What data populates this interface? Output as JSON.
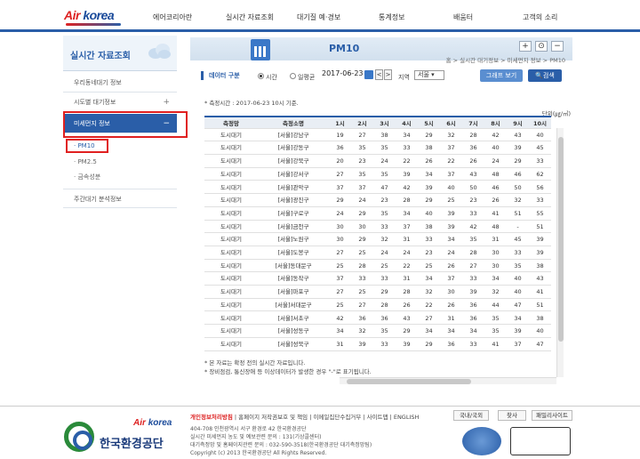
{
  "header": {
    "logo_air": "Air",
    "logo_korea": "korea",
    "nav": [
      "에어코리아란",
      "실시간 자료조회",
      "대기질 예·경보",
      "통계정보",
      "배움터",
      "고객의 소리"
    ]
  },
  "sidebar": {
    "title": "실시간 자료조회",
    "items": [
      {
        "label": "우리동네대기 정보",
        "plus": ""
      },
      {
        "label": "시도별 대기정보",
        "plus": "+"
      },
      {
        "label": "미세먼지 정보",
        "plus": "−"
      },
      {
        "label": "주간대기 분석정보",
        "plus": ""
      }
    ],
    "subitems": [
      "PM10",
      "PM2.5",
      "금속성분"
    ]
  },
  "page": {
    "title": "PM10",
    "breadcrumb": "홈 > 실시간 대기정보 > 미세먼지 정보 > PM10",
    "zoom_in": "+",
    "zoom_reset": "⊙",
    "zoom_out": "−"
  },
  "filter": {
    "label": "데이터 구분",
    "opt_hour": "시간",
    "opt_day": "일평균",
    "date": "2017-06-23",
    "prev": "<",
    "next": ">",
    "region_label": "지역",
    "region_value": "서울",
    "graph_button": "그래프 보기",
    "search_button": "검색"
  },
  "measure_time": "* 측정시간 : 2017-06-23 10시 기준.",
  "unit": "단위(㎍/㎥)",
  "table": {
    "headers": [
      "측정망",
      "측정소명",
      "1시",
      "2시",
      "3시",
      "4시",
      "5시",
      "6시",
      "7시",
      "8시",
      "9시",
      "10시"
    ],
    "rows": [
      [
        "도시대기",
        "[서울]강남구",
        "19",
        "27",
        "38",
        "34",
        "29",
        "32",
        "28",
        "42",
        "43",
        "40"
      ],
      [
        "도시대기",
        "[서울]강동구",
        "36",
        "35",
        "35",
        "33",
        "38",
        "37",
        "36",
        "40",
        "39",
        "45"
      ],
      [
        "도시대기",
        "[서울]강북구",
        "20",
        "23",
        "24",
        "22",
        "26",
        "22",
        "26",
        "24",
        "29",
        "33"
      ],
      [
        "도시대기",
        "[서울]강서구",
        "27",
        "35",
        "35",
        "39",
        "34",
        "37",
        "43",
        "48",
        "46",
        "62"
      ],
      [
        "도시대기",
        "[서울]관악구",
        "37",
        "37",
        "47",
        "42",
        "39",
        "40",
        "50",
        "46",
        "50",
        "56"
      ],
      [
        "도시대기",
        "[서울]광진구",
        "29",
        "24",
        "23",
        "28",
        "29",
        "25",
        "23",
        "26",
        "32",
        "33"
      ],
      [
        "도시대기",
        "[서울]구로구",
        "24",
        "29",
        "35",
        "34",
        "40",
        "39",
        "33",
        "41",
        "51",
        "55"
      ],
      [
        "도시대기",
        "[서울]금천구",
        "30",
        "30",
        "33",
        "37",
        "38",
        "39",
        "42",
        "48",
        "-",
        "51"
      ],
      [
        "도시대기",
        "[서울]노원구",
        "30",
        "29",
        "32",
        "31",
        "33",
        "34",
        "35",
        "31",
        "45",
        "39"
      ],
      [
        "도시대기",
        "[서울]도봉구",
        "27",
        "25",
        "24",
        "24",
        "23",
        "24",
        "28",
        "30",
        "33",
        "39"
      ],
      [
        "도시대기",
        "[서울]동대문구",
        "25",
        "28",
        "25",
        "22",
        "25",
        "26",
        "27",
        "30",
        "35",
        "38"
      ],
      [
        "도시대기",
        "[서울]동작구",
        "37",
        "33",
        "33",
        "31",
        "34",
        "37",
        "33",
        "34",
        "40",
        "43"
      ],
      [
        "도시대기",
        "[서울]마포구",
        "27",
        "25",
        "29",
        "28",
        "32",
        "30",
        "39",
        "32",
        "40",
        "41"
      ],
      [
        "도시대기",
        "[서울]서대문구",
        "25",
        "27",
        "28",
        "26",
        "22",
        "26",
        "36",
        "44",
        "47",
        "51"
      ],
      [
        "도시대기",
        "[서울]서초구",
        "42",
        "36",
        "36",
        "43",
        "27",
        "31",
        "36",
        "35",
        "34",
        "38"
      ],
      [
        "도시대기",
        "[서울]성동구",
        "34",
        "32",
        "35",
        "29",
        "34",
        "34",
        "34",
        "35",
        "39",
        "40"
      ],
      [
        "도시대기",
        "[서울]성북구",
        "31",
        "39",
        "33",
        "39",
        "29",
        "36",
        "33",
        "41",
        "37",
        "47"
      ]
    ]
  },
  "notes": [
    "* 본 자료는 확정 전의 실시간 자료입니다.",
    "* 장비점검, 통신장애 등 이상데이터가 발생한 경우 \"-\"로 표기됩니다."
  ],
  "footer": {
    "links_priv": "개인정보처리방침",
    "links_rest": " | 홈페이지 저작권보호 및 책임 | 이메일집단수집거부 | 사이트맵 | ENGLISH",
    "btn1": "국내/국외",
    "btn2": "찾사",
    "btn3": "패밀리사이트",
    "addr": [
      "404-708 인천광역시 서구 환경로 42 한국환경공단",
      "실시간 미세먼지 농도 및 예보관련 문의 : 131(기상콜센터)",
      "대기측정망 및 홈페이지관련 문의 : 032-590-3518(한국환경공단 대기측정망팀)",
      "Copyright (c) 2013 한국환경공단 All Rights Reserved."
    ],
    "corp": "한국환경공단",
    "logo_air": "Air",
    "logo_korea": "korea"
  }
}
